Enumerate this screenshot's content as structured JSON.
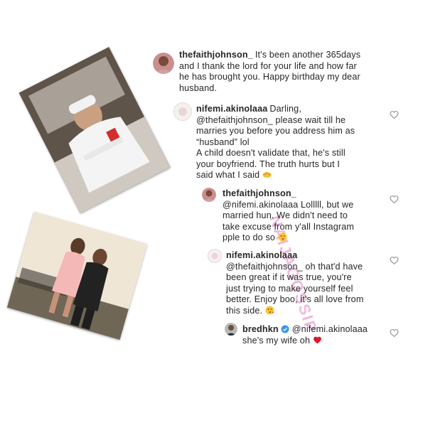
{
  "post": {
    "username": "thefaithjohnson_",
    "caption_lines": [
      "It's been another 365days",
      "and I thank the lord for your life and how far",
      "he has brought you. Happy birthday my dear",
      "husband."
    ]
  },
  "comments": [
    {
      "username": "nifemi.akinolaaa",
      "lines": [
        "Darling,",
        "@thefaithjohnson_ please wait till he",
        "marries you before you address him as",
        "“husband” lol",
        "A child doesn't validate that, he's still",
        "your boyfriend. The truth hurts but I",
        "said what I said"
      ]
    },
    {
      "username": "thefaithjohnson_",
      "lines": [
        "@nifemi.akinolaaa Lolllll, but we",
        "married hun. We didn't need to",
        "take excuse from y'all Instagram",
        "pple to do so"
      ]
    },
    {
      "username": "nifemi.akinolaaa",
      "lines": [
        "@thefaithjohnson_ oh that'd have",
        "been great if it was true, you're",
        "just trying to make yourself feel",
        "better. Enjoy boo, it's all love from",
        "this side."
      ]
    },
    {
      "username": "bredhkn",
      "mention": "@nifemi.akinolaaa",
      "text": "she's my wife oh"
    }
  ],
  "icons": {
    "like": "heart-outline-icon",
    "verified": "verified-badge-icon",
    "emoji_shake": "handshake-emoji",
    "emoji_wink": "winking-tongue-emoji",
    "emoji_kiss": "kiss-emoji",
    "emoji_heart": "red-heart-emoji"
  },
  "colors": {
    "text": "#262626",
    "heart_outline": "#8e8e8e",
    "verified_blue": "#3897f0",
    "watermark": "#cd3aa0",
    "red_heart": "#e0152b"
  },
  "watermark": "NAIJAGOSSIP"
}
